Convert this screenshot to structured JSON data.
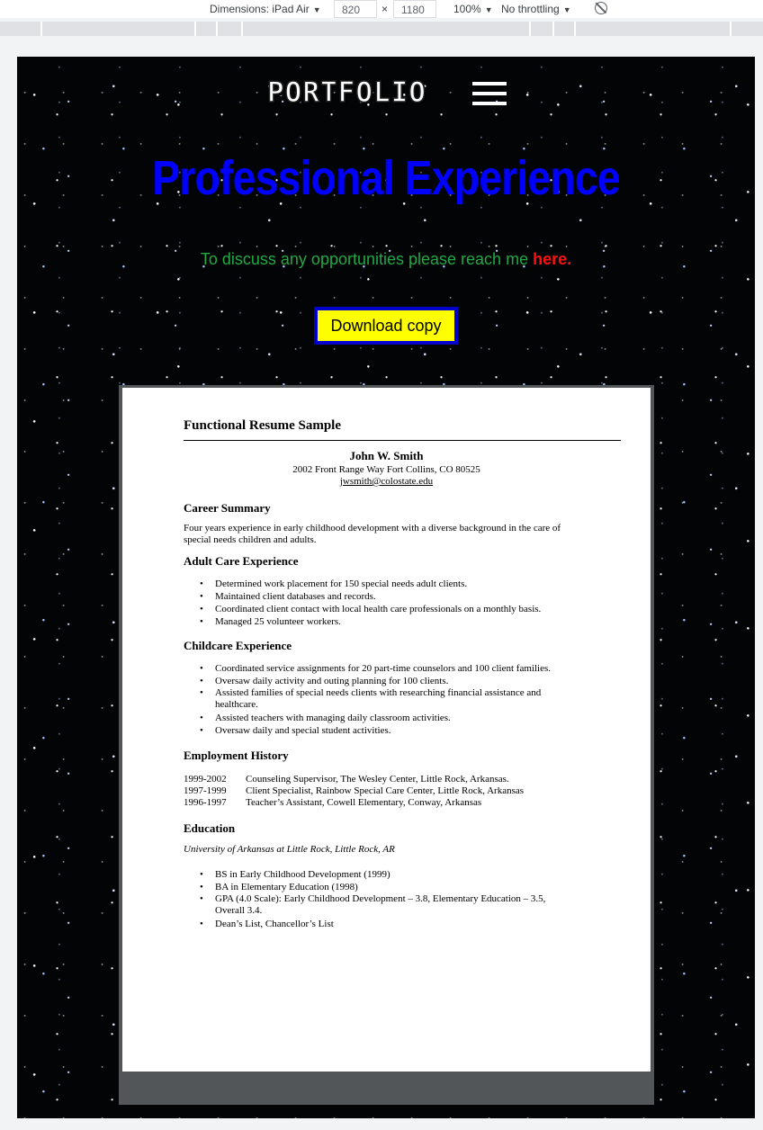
{
  "devtools": {
    "dimensions_label": "Dimensions: iPad Air",
    "width_value": "820",
    "times": "×",
    "height_value": "1180",
    "zoom": "100%",
    "throttle": "No throttling",
    "caret": "▼"
  },
  "nav": {
    "logo": "PORTFOLIO"
  },
  "hero": {
    "title": "Professional Experience",
    "contact_text": "To discuss any opportunities please reach me ",
    "contact_link": "here.",
    "download_label": "Download copy"
  },
  "resume": {
    "heading": "Functional Resume Sample",
    "name": "John W. Smith",
    "address": "2002 Front Range Way Fort Collins, CO 80525",
    "email": "jwsmith@colostate.edu",
    "career_title": "Career Summary",
    "career_text_1": "Four years experience in early childhood development with a diverse background in the care of",
    "career_text_2": "special needs children and adults.",
    "adult_title": "Adult Care Experience",
    "adult_items": [
      "Determined work placement for 150 special needs adult clients.",
      "Maintained client databases and records.",
      "Coordinated client contact with local health care professionals on a monthly basis.",
      "Managed 25 volunteer workers."
    ],
    "child_title": "Childcare Experience",
    "child_items": [
      "Coordinated service assignments for 20 part-time counselors and 100 client families.",
      "Oversaw daily activity and outing planning for 100 clients.",
      "Assisted families of special needs clients with researching financial assistance and healthcare.",
      "Assisted teachers with managing daily classroom activities.",
      "Oversaw daily and special student activities."
    ],
    "employment_title": "Employment History",
    "employment": [
      {
        "years": "1999-2002",
        "role": "Counseling Supervisor, The Wesley Center, Little Rock, Arkansas."
      },
      {
        "years": "1997-1999",
        "role": "Client Specialist, Rainbow Special Care Center, Little Rock, Arkansas"
      },
      {
        "years": "1996-1997",
        "role": "Teacher’s Assistant, Cowell Elementary, Conway, Arkansas"
      }
    ],
    "education_title": "Education",
    "school": "University of Arkansas at Little Rock, Little Rock, AR",
    "education_items": [
      "BS in Early Childhood Development (1999)",
      "BA in Elementary Education (1998)",
      "GPA (4.0 Scale):  Early Childhood Development – 3.8, Elementary Education – 3.5, Overall 3.4.",
      "Dean’s List, Chancellor’s List"
    ]
  }
}
